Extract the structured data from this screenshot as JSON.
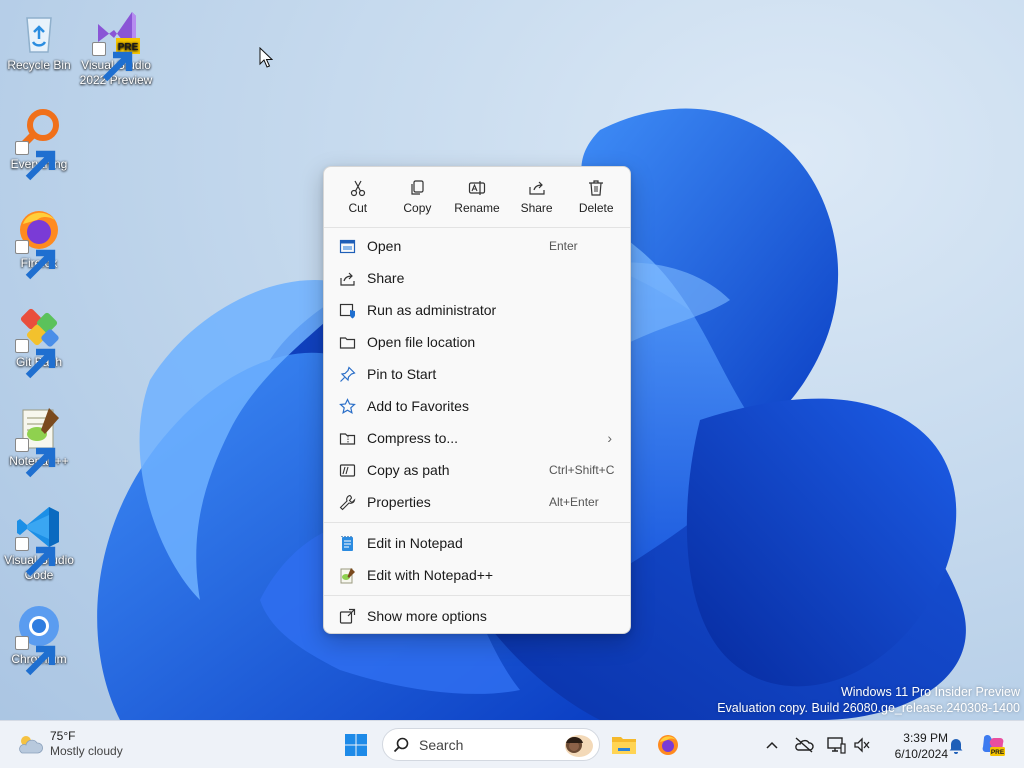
{
  "desktop": {
    "icons": [
      {
        "label": "Recycle Bin",
        "icon": "recycle-bin-icon"
      },
      {
        "label": "Visual Studio 2022 Preview",
        "line1": "Visual Studio",
        "line2": "2022 Preview",
        "badge": "PRE",
        "icon": "visual-studio-icon"
      },
      {
        "label": "Everything",
        "icon": "everything-icon"
      },
      {
        "label": "Firefox",
        "icon": "firefox-icon"
      },
      {
        "label": "Git Bash",
        "icon": "git-bash-icon"
      },
      {
        "label": "Notepad++",
        "icon": "notepad-plus-plus-icon"
      },
      {
        "label": "Visual Studio Code",
        "line1": "Visual Studio",
        "line2": "Code",
        "icon": "vscode-icon"
      },
      {
        "label": "Chromium",
        "icon": "chromium-icon"
      }
    ]
  },
  "context_menu": {
    "quick_actions": [
      {
        "label": "Cut",
        "icon": "scissors-icon"
      },
      {
        "label": "Copy",
        "icon": "copy-icon"
      },
      {
        "label": "Rename",
        "icon": "rename-icon"
      },
      {
        "label": "Share",
        "icon": "share-icon"
      },
      {
        "label": "Delete",
        "icon": "trash-icon"
      }
    ],
    "items": [
      {
        "label": "Open",
        "shortcut": "Enter",
        "icon": "open-window-icon"
      },
      {
        "label": "Share",
        "shortcut": "",
        "icon": "share-icon"
      },
      {
        "label": "Run as administrator",
        "shortcut": "",
        "icon": "shield-admin-icon"
      },
      {
        "label": "Open file location",
        "shortcut": "",
        "icon": "folder-icon"
      },
      {
        "label": "Pin to Start",
        "shortcut": "",
        "icon": "pin-icon"
      },
      {
        "label": "Add to Favorites",
        "shortcut": "",
        "icon": "star-icon"
      },
      {
        "label": "Compress to...",
        "shortcut": "",
        "icon": "zip-folder-icon",
        "submenu": true
      },
      {
        "label": "Copy as path",
        "shortcut": "Ctrl+Shift+C",
        "icon": "copy-path-icon"
      },
      {
        "label": "Properties",
        "shortcut": "Alt+Enter",
        "icon": "wrench-icon"
      }
    ],
    "extra_items": [
      {
        "label": "Edit in Notepad",
        "icon": "notepad-icon"
      },
      {
        "label": "Edit with Notepad++",
        "icon": "notepad-plus-plus-icon"
      }
    ],
    "more": {
      "label": "Show more options",
      "icon": "show-more-icon"
    }
  },
  "watermark": {
    "line1": "Windows 11 Pro Insider Preview",
    "line2": "Evaluation copy. Build 26080.ge_release.240308-1400"
  },
  "taskbar": {
    "weather": {
      "temp": "75°F",
      "condition": "Mostly cloudy",
      "icon": "cloud-sun-icon"
    },
    "search_placeholder": "Search",
    "pinned": [
      {
        "name": "start",
        "icon": "windows-logo-icon"
      },
      {
        "name": "file-explorer",
        "icon": "folder-icon"
      },
      {
        "name": "firefox",
        "icon": "firefox-icon"
      }
    ],
    "tray": [
      {
        "name": "show-hidden",
        "icon": "chevron-up-icon"
      },
      {
        "name": "onedrive",
        "icon": "cloud-off-icon"
      },
      {
        "name": "network",
        "icon": "network-icon"
      },
      {
        "name": "volume",
        "icon": "volume-icon"
      }
    ],
    "clock": {
      "time": "3:39 PM",
      "date": "6/10/2024"
    },
    "accent": "#0078d4"
  }
}
